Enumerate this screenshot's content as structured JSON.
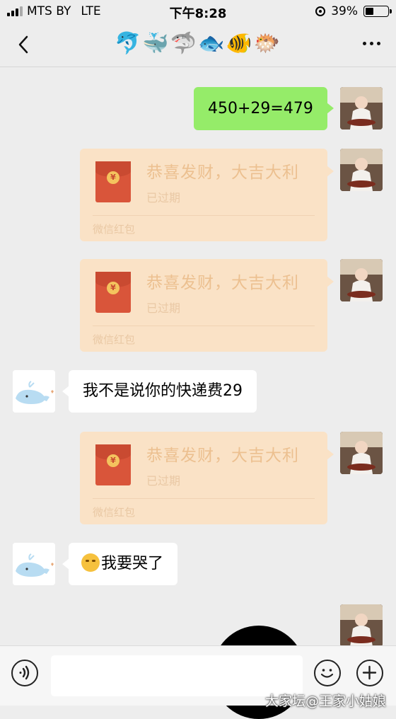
{
  "status_bar": {
    "carrier": "MTS BY",
    "network": "LTE",
    "time": "下午8:28",
    "battery": "39%",
    "battery_level": 0.39
  },
  "nav": {
    "title": "🐬🐳🦈🐟🐠🐡",
    "icons": [
      "back-chevron-icon",
      "more-dots-icon"
    ]
  },
  "messages": [
    {
      "side": "right",
      "type": "text",
      "text": "450+29=479"
    },
    {
      "side": "right",
      "type": "red_packet",
      "title": "恭喜发财，大吉大利",
      "status": "已过期",
      "footer": "微信红包"
    },
    {
      "side": "right",
      "type": "red_packet",
      "title": "恭喜发财，大吉大利",
      "status": "已过期",
      "footer": "微信红包"
    },
    {
      "side": "left",
      "type": "text",
      "text": "我不是说你的快递费29"
    },
    {
      "side": "right",
      "type": "red_packet",
      "title": "恭喜发财，大吉大利",
      "status": "已过期",
      "footer": "微信红包"
    },
    {
      "side": "left",
      "type": "text",
      "text": "我要哭了",
      "emoji": "crying-face-icon"
    }
  ],
  "input_bar": {
    "placeholder": "",
    "icons": [
      "voice-icon",
      "emoji-face-icon",
      "plus-icon"
    ]
  },
  "watermark": "大家坛@王家小姑娘",
  "colors": {
    "background": "#ededed",
    "sent_bubble": "#95ec69",
    "received_bubble": "#ffffff",
    "red_packet_expired": "#fae2c6",
    "envelope": "#d9553a"
  }
}
